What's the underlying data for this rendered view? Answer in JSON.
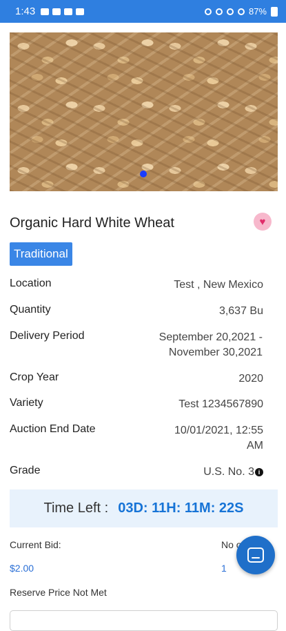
{
  "status_bar": {
    "time": "1:43",
    "battery": "87%"
  },
  "product": {
    "title": "Organic Hard White Wheat",
    "badge": "Traditional",
    "details": [
      {
        "label": "Location",
        "value": "Test , New Mexico"
      },
      {
        "label": "Quantity",
        "value": "3,637 Bu"
      },
      {
        "label": "Delivery Period",
        "value_line1": "September 20,2021 -",
        "value_line2": "November 30,2021"
      },
      {
        "label": "Crop Year",
        "value": "2020"
      },
      {
        "label": "Variety",
        "value": "Test 1234567890"
      },
      {
        "label": "Auction End Date",
        "value_line1": "10/01/2021, 12:55",
        "value_line2": "AM"
      },
      {
        "label": "Grade",
        "value": "U.S. No. 3"
      }
    ]
  },
  "time_left": {
    "label": "Time Left :",
    "value": "03D: 11H: 11M: 22S"
  },
  "bid": {
    "current_label": "Current Bid:",
    "current_value": "$2.00",
    "no_bids_label": "No of",
    "no_bids_value": "1",
    "reserve_text": "Reserve Price Not Met"
  },
  "icons": {
    "favorite": "heart-icon",
    "chat": "chat-icon",
    "grade_info": "info-icon"
  },
  "colors": {
    "status_bar": "#2f7fe0",
    "accent": "#3a86e6",
    "timer": "#1673d6",
    "heart": "#e02d6a"
  }
}
